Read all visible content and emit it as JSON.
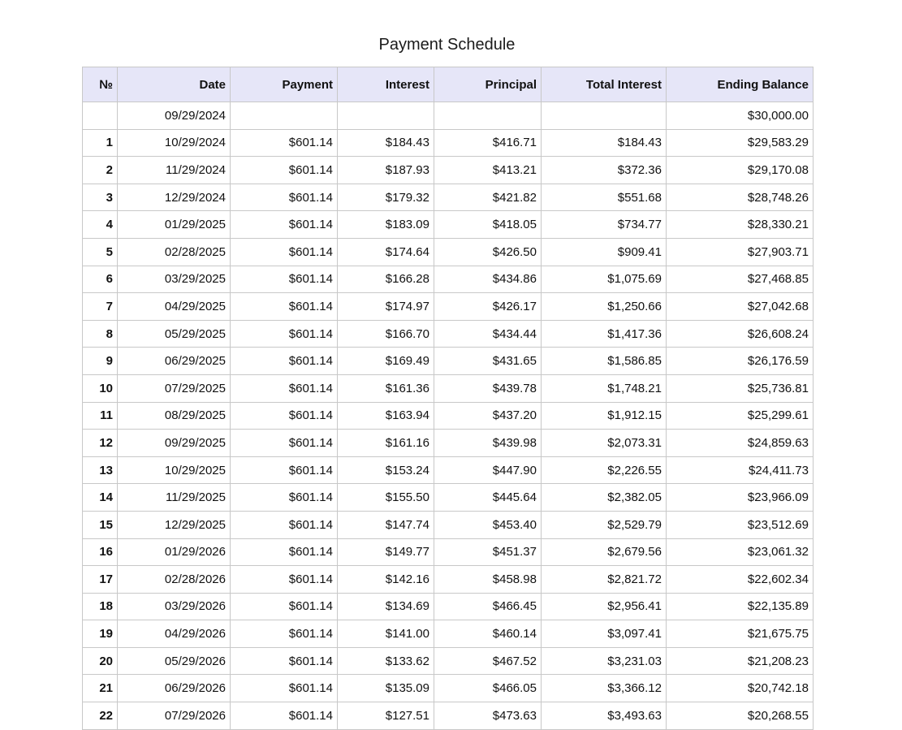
{
  "page": {
    "title": "Payment Schedule"
  },
  "table": {
    "columns": [
      "№",
      "Date",
      "Payment",
      "Interest",
      "Principal",
      "Total Interest",
      "Ending Balance"
    ],
    "rows": [
      [
        "",
        "09/29/2024",
        "",
        "",
        "",
        "",
        "$30,000.00"
      ],
      [
        "1",
        "10/29/2024",
        "$601.14",
        "$184.43",
        "$416.71",
        "$184.43",
        "$29,583.29"
      ],
      [
        "2",
        "11/29/2024",
        "$601.14",
        "$187.93",
        "$413.21",
        "$372.36",
        "$29,170.08"
      ],
      [
        "3",
        "12/29/2024",
        "$601.14",
        "$179.32",
        "$421.82",
        "$551.68",
        "$28,748.26"
      ],
      [
        "4",
        "01/29/2025",
        "$601.14",
        "$183.09",
        "$418.05",
        "$734.77",
        "$28,330.21"
      ],
      [
        "5",
        "02/28/2025",
        "$601.14",
        "$174.64",
        "$426.50",
        "$909.41",
        "$27,903.71"
      ],
      [
        "6",
        "03/29/2025",
        "$601.14",
        "$166.28",
        "$434.86",
        "$1,075.69",
        "$27,468.85"
      ],
      [
        "7",
        "04/29/2025",
        "$601.14",
        "$174.97",
        "$426.17",
        "$1,250.66",
        "$27,042.68"
      ],
      [
        "8",
        "05/29/2025",
        "$601.14",
        "$166.70",
        "$434.44",
        "$1,417.36",
        "$26,608.24"
      ],
      [
        "9",
        "06/29/2025",
        "$601.14",
        "$169.49",
        "$431.65",
        "$1,586.85",
        "$26,176.59"
      ],
      [
        "10",
        "07/29/2025",
        "$601.14",
        "$161.36",
        "$439.78",
        "$1,748.21",
        "$25,736.81"
      ],
      [
        "11",
        "08/29/2025",
        "$601.14",
        "$163.94",
        "$437.20",
        "$1,912.15",
        "$25,299.61"
      ],
      [
        "12",
        "09/29/2025",
        "$601.14",
        "$161.16",
        "$439.98",
        "$2,073.31",
        "$24,859.63"
      ],
      [
        "13",
        "10/29/2025",
        "$601.14",
        "$153.24",
        "$447.90",
        "$2,226.55",
        "$24,411.73"
      ],
      [
        "14",
        "11/29/2025",
        "$601.14",
        "$155.50",
        "$445.64",
        "$2,382.05",
        "$23,966.09"
      ],
      [
        "15",
        "12/29/2025",
        "$601.14",
        "$147.74",
        "$453.40",
        "$2,529.79",
        "$23,512.69"
      ],
      [
        "16",
        "01/29/2026",
        "$601.14",
        "$149.77",
        "$451.37",
        "$2,679.56",
        "$23,061.32"
      ],
      [
        "17",
        "02/28/2026",
        "$601.14",
        "$142.16",
        "$458.98",
        "$2,821.72",
        "$22,602.34"
      ],
      [
        "18",
        "03/29/2026",
        "$601.14",
        "$134.69",
        "$466.45",
        "$2,956.41",
        "$22,135.89"
      ],
      [
        "19",
        "04/29/2026",
        "$601.14",
        "$141.00",
        "$460.14",
        "$3,097.41",
        "$21,675.75"
      ],
      [
        "20",
        "05/29/2026",
        "$601.14",
        "$133.62",
        "$467.52",
        "$3,231.03",
        "$21,208.23"
      ],
      [
        "21",
        "06/29/2026",
        "$601.14",
        "$135.09",
        "$466.05",
        "$3,366.12",
        "$20,742.18"
      ],
      [
        "22",
        "07/29/2026",
        "$601.14",
        "$127.51",
        "$473.63",
        "$3,493.63",
        "$20,268.55"
      ]
    ]
  },
  "colors": {
    "header_bg": "#e6e6f8",
    "grid_line": "#c8c8c8"
  }
}
